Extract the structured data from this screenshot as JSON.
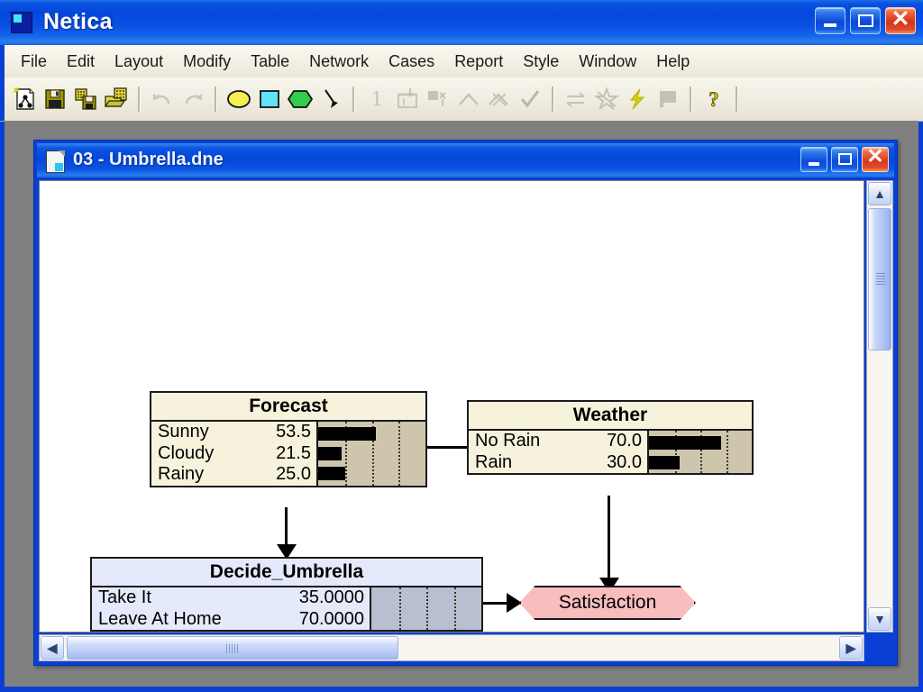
{
  "app": {
    "title": "Netica",
    "icon": "netica-logo-icon"
  },
  "window_controls": {
    "minimize": "minimize-button",
    "maximize": "maximize-button",
    "close": "close-button"
  },
  "menu": {
    "items": [
      {
        "label": "File"
      },
      {
        "label": "Edit"
      },
      {
        "label": "Layout"
      },
      {
        "label": "Modify"
      },
      {
        "label": "Table"
      },
      {
        "label": "Network"
      },
      {
        "label": "Cases"
      },
      {
        "label": "Report"
      },
      {
        "label": "Style"
      },
      {
        "label": "Window"
      },
      {
        "label": "Help"
      }
    ]
  },
  "toolbar": {
    "groups": [
      {
        "buttons": [
          {
            "icon": "new-network-icon",
            "enabled": true
          },
          {
            "icon": "save-icon",
            "enabled": true
          },
          {
            "icon": "save-as-icon",
            "enabled": true
          },
          {
            "icon": "open-folder-icon",
            "enabled": true
          }
        ]
      },
      {
        "buttons": [
          {
            "icon": "undo-icon",
            "enabled": false
          },
          {
            "icon": "redo-icon",
            "enabled": false
          }
        ]
      },
      {
        "buttons": [
          {
            "icon": "nature-node-icon",
            "enabled": true
          },
          {
            "icon": "decision-node-icon",
            "enabled": true
          },
          {
            "icon": "utility-node-icon",
            "enabled": true
          },
          {
            "icon": "link-arrow-icon",
            "enabled": true
          }
        ]
      },
      {
        "buttons": [
          {
            "icon": "number-one-icon",
            "enabled": false
          },
          {
            "icon": "compile-net-icon",
            "enabled": false
          },
          {
            "icon": "node-absorb-icon",
            "enabled": false
          },
          {
            "icon": "reverse-link-icon",
            "enabled": false
          },
          {
            "icon": "remove-link-icon",
            "enabled": false
          },
          {
            "icon": "check-mark-icon",
            "enabled": false
          }
        ]
      },
      {
        "buttons": [
          {
            "icon": "swap-arrows-icon",
            "enabled": false
          },
          {
            "icon": "star-burst-icon",
            "enabled": false
          },
          {
            "icon": "lightning-bolt-icon",
            "enabled": false
          },
          {
            "icon": "flag-icon",
            "enabled": false
          }
        ]
      },
      {
        "buttons": [
          {
            "icon": "help-question-icon",
            "enabled": true
          }
        ]
      }
    ]
  },
  "document_window": {
    "title": "03 - Umbrella.dne",
    "icon": "document-icon",
    "controls": {
      "minimize": "minimize-button",
      "maximize": "maximize-button",
      "close": "close-button"
    }
  },
  "network": {
    "nodes": [
      {
        "id": "forecast",
        "name": "Forecast",
        "type": "chance",
        "states": [
          {
            "label": "Sunny",
            "value": "53.5",
            "percent": 53.5
          },
          {
            "label": "Cloudy",
            "value": "21.5",
            "percent": 21.5
          },
          {
            "label": "Rainy",
            "value": "25.0",
            "percent": 25.0
          }
        ]
      },
      {
        "id": "weather",
        "name": "Weather",
        "type": "chance",
        "states": [
          {
            "label": "No Rain",
            "value": "70.0",
            "percent": 70.0
          },
          {
            "label": "Rain",
            "value": "30.0",
            "percent": 30.0
          }
        ]
      },
      {
        "id": "decide_umbrella",
        "name": "Decide_Umbrella",
        "type": "decision",
        "states": [
          {
            "label": "Take It",
            "value": "35.0000",
            "percent": 0
          },
          {
            "label": "Leave At Home",
            "value": "70.0000",
            "percent": 0
          }
        ]
      },
      {
        "id": "satisfaction",
        "name": "Satisfaction",
        "type": "utility",
        "states": []
      }
    ],
    "links": [
      {
        "from": "weather",
        "to": "forecast",
        "direction": "left"
      },
      {
        "from": "forecast",
        "to": "decide_umbrella",
        "direction": "down"
      },
      {
        "from": "weather",
        "to": "satisfaction",
        "direction": "down"
      },
      {
        "from": "decide_umbrella",
        "to": "satisfaction",
        "direction": "right"
      }
    ]
  },
  "scrollbars": {
    "vertical": {
      "up": "scroll-up-arrow",
      "down": "scroll-down-arrow"
    },
    "horizontal": {
      "left": "scroll-left-arrow",
      "right": "scroll-right-arrow"
    }
  },
  "colors": {
    "titlebar_blue": "#0a4fe2",
    "chance_node_fill": "#f7f2dc",
    "chance_bar_track": "#cdc6ad",
    "decision_node_fill": "#e4eafb",
    "decision_bar_track": "#b8bfd0",
    "utility_node_fill": "#f9bdbd",
    "menu_background": "#f2efe2"
  }
}
